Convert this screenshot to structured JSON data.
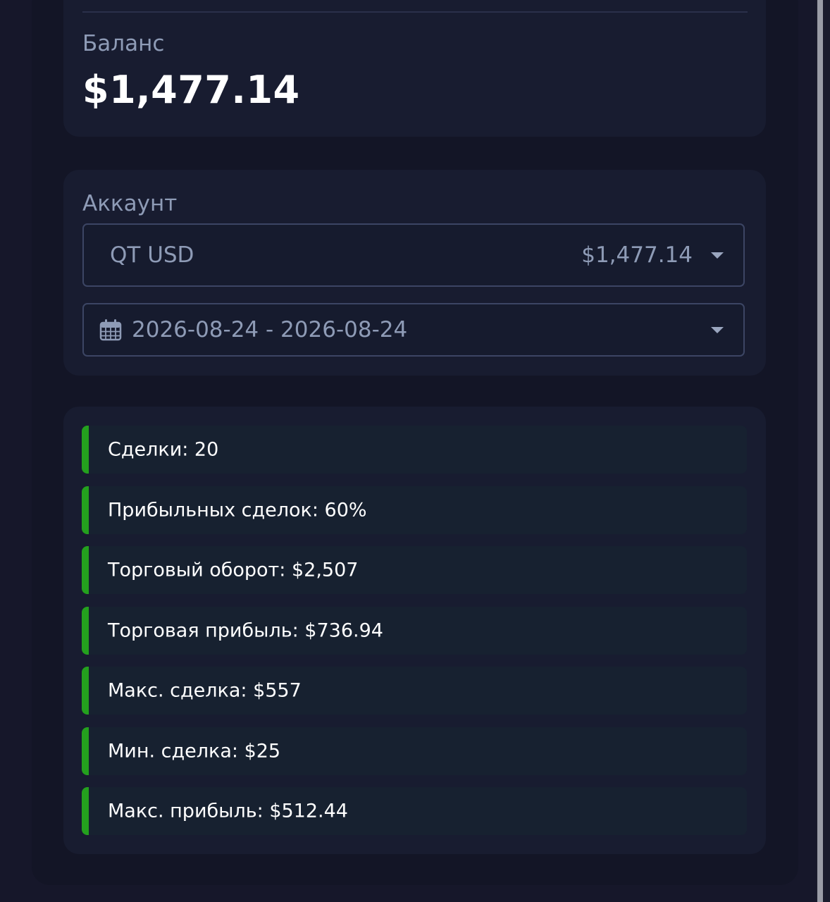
{
  "balance": {
    "label": "Баланс",
    "value": "$1,477.14"
  },
  "account": {
    "label": "Аккаунт",
    "selected_account": "QT USD",
    "selected_amount": "$1,477.14",
    "date_range": "2026-08-24 - 2026-08-24"
  },
  "stats": [
    {
      "text": "Сделки: 20"
    },
    {
      "text": "Прибыльных сделок: 60%"
    },
    {
      "text": "Торговый оборот: $2,507"
    },
    {
      "text": "Торговая прибыль: $736.94"
    },
    {
      "text": "Макс. сделка: $557"
    },
    {
      "text": "Мин. сделка: $25"
    },
    {
      "text": "Макс. прибыль: $512.44"
    }
  ],
  "colors": {
    "accent_green": "#24a01e",
    "background": "#16172a",
    "card": "#181c30",
    "muted_text": "#8e9bb6"
  }
}
